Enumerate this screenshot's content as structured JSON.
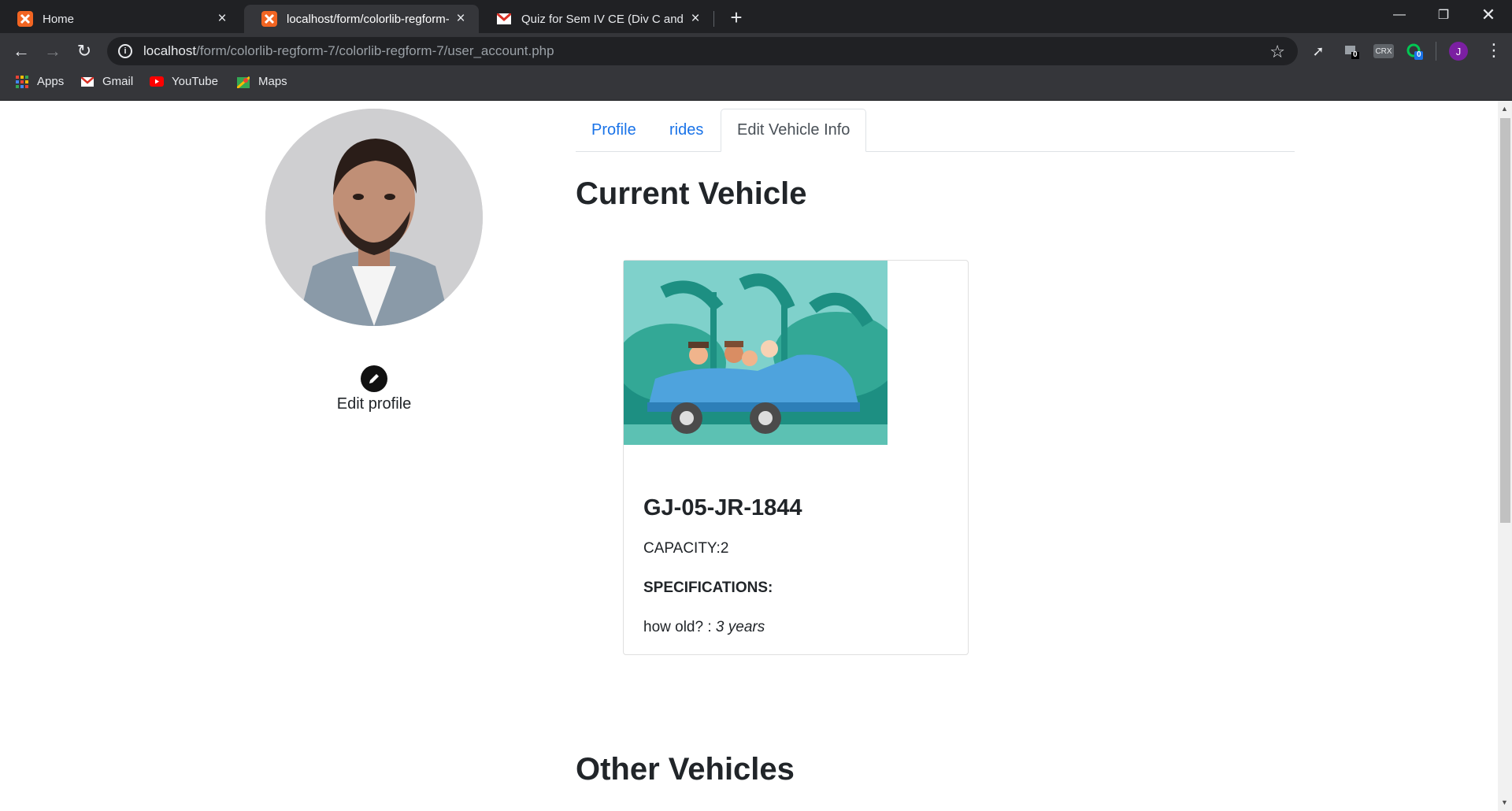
{
  "browser": {
    "tabs": [
      {
        "title": "Home"
      },
      {
        "title": "localhost/form/colorlib-regform-"
      },
      {
        "title": "Quiz for Sem IV CE (Div C and D)"
      }
    ],
    "url_host": "localhost",
    "url_path": "/form/colorlib-regform-7/colorlib-regform-7/user_account.php",
    "bookmarks": [
      "Apps",
      "Gmail",
      "YouTube",
      "Maps"
    ],
    "profile_initial": "J",
    "ext_badge_1": "0",
    "ext_crx": "CRX",
    "ext_badge_2": "0"
  },
  "sidebar": {
    "edit_label": "Edit profile"
  },
  "nav_tabs": [
    {
      "label": "Profile"
    },
    {
      "label": "rides"
    },
    {
      "label": "Edit Vehicle Info"
    }
  ],
  "current_section_title": "Current Vehicle",
  "vehicle": {
    "plate": "GJ-05-JR-1844",
    "capacity": "CAPACITY:2",
    "spec_heading": "SPECIFICATIONS:",
    "age_label": "how old? : ",
    "age_value": "3 years"
  },
  "other_section_title": "Other Vehicles",
  "colors": {
    "link": "#1a73e8",
    "chrome_dark": "#202124",
    "chrome_toolbar": "#35363a"
  }
}
